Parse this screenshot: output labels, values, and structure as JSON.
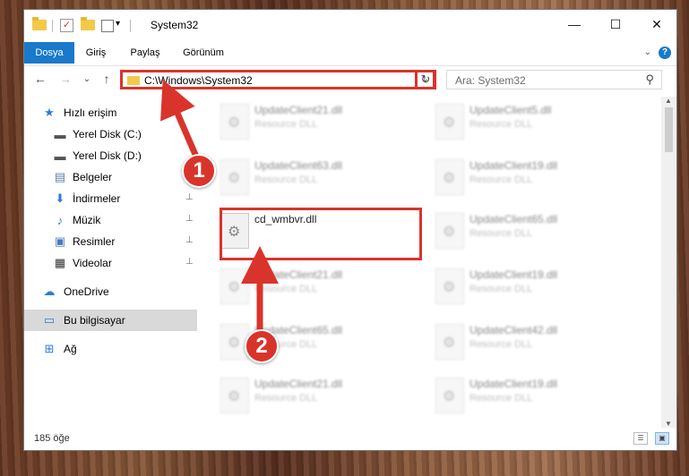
{
  "window": {
    "title": "System32",
    "minimize": "—",
    "maximize": "☐",
    "close": "✕"
  },
  "ribbon": {
    "tabs": [
      {
        "label": "Dosya",
        "active": true
      },
      {
        "label": "Giriş",
        "active": false
      },
      {
        "label": "Paylaş",
        "active": false
      },
      {
        "label": "Görünüm",
        "active": false
      }
    ],
    "help": "?",
    "collapse": "⌄"
  },
  "navbar": {
    "back": "←",
    "forward": "→",
    "recent": "⌄",
    "up": "↑",
    "address": "C:\\Windows\\System32",
    "address_dropdown": "⌄",
    "refresh": "↻",
    "search_placeholder": "Ara: System32",
    "search_icon": "⚲"
  },
  "navpane": {
    "items": [
      {
        "label": "Hızlı erişim",
        "icon": "star-icon",
        "glyph": "★",
        "color": "#2b7cd3",
        "pinned": false
      },
      {
        "label": "Yerel Disk (C:)",
        "icon": "drive-icon",
        "glyph": "▬",
        "color": "#555",
        "pinned": false
      },
      {
        "label": "Yerel Disk (D:)",
        "icon": "drive-icon",
        "glyph": "▬",
        "color": "#555",
        "pinned": false
      },
      {
        "label": "Belgeler",
        "icon": "documents-icon",
        "glyph": "▤",
        "color": "#5a7fa8",
        "pinned": true
      },
      {
        "label": "İndirmeler",
        "icon": "download-icon",
        "glyph": "⬇",
        "color": "#2b7cd3",
        "pinned": true
      },
      {
        "label": "Müzik",
        "icon": "music-icon",
        "glyph": "♪",
        "color": "#2b7cd3",
        "pinned": true
      },
      {
        "label": "Resimler",
        "icon": "pictures-icon",
        "glyph": "▣",
        "color": "#4a7ab8",
        "pinned": true
      },
      {
        "label": "Videolar",
        "icon": "video-icon",
        "glyph": "▦",
        "color": "#333",
        "pinned": true
      },
      {
        "label": "OneDrive",
        "icon": "cloud-icon",
        "glyph": "☁",
        "color": "#2b7cd3",
        "pinned": false
      },
      {
        "label": "Bu bilgisayar",
        "icon": "computer-icon",
        "glyph": "▭",
        "color": "#2b7cd3",
        "pinned": false,
        "selected": true
      },
      {
        "label": "Ağ",
        "icon": "network-icon",
        "glyph": "⊞",
        "color": "#2b7cd3",
        "pinned": false
      }
    ],
    "pin_glyph": "📌"
  },
  "files": {
    "left_column": [
      {
        "name": "UpdateClient21.dll",
        "desc": "Resource DLL",
        "blurred": true
      },
      {
        "name": "UpdateClient63.dll",
        "desc": "Resource DLL",
        "blurred": true
      },
      {
        "name": "cd_wmbvr.dll",
        "desc": "",
        "blurred": false
      },
      {
        "name": "UpdateClient21.dll",
        "desc": "Resource DLL",
        "blurred": true
      },
      {
        "name": "UpdateClient65.dll",
        "desc": "Resource DLL",
        "blurred": true
      },
      {
        "name": "UpdateClient21.dll",
        "desc": "Resource DLL",
        "blurred": true
      }
    ],
    "right_column": [
      {
        "name": "UpdateClient5.dll",
        "desc": "Resource DLL",
        "blurred": true
      },
      {
        "name": "UpdateClient19.dll",
        "desc": "Resource DLL",
        "blurred": true
      },
      {
        "name": "UpdateClient65.dll",
        "desc": "Resource DLL",
        "blurred": true
      },
      {
        "name": "UpdateClient19.dll",
        "desc": "Resource DLL",
        "blurred": true
      },
      {
        "name": "UpdateClient42.dll",
        "desc": "Resource DLL",
        "blurred": true
      },
      {
        "name": "UpdateClient19.dll",
        "desc": "Resource DLL",
        "blurred": true
      }
    ]
  },
  "status": {
    "count": "185 öğe"
  },
  "annotations": {
    "step1": "1",
    "step2": "2",
    "accent": "#d9342b"
  }
}
